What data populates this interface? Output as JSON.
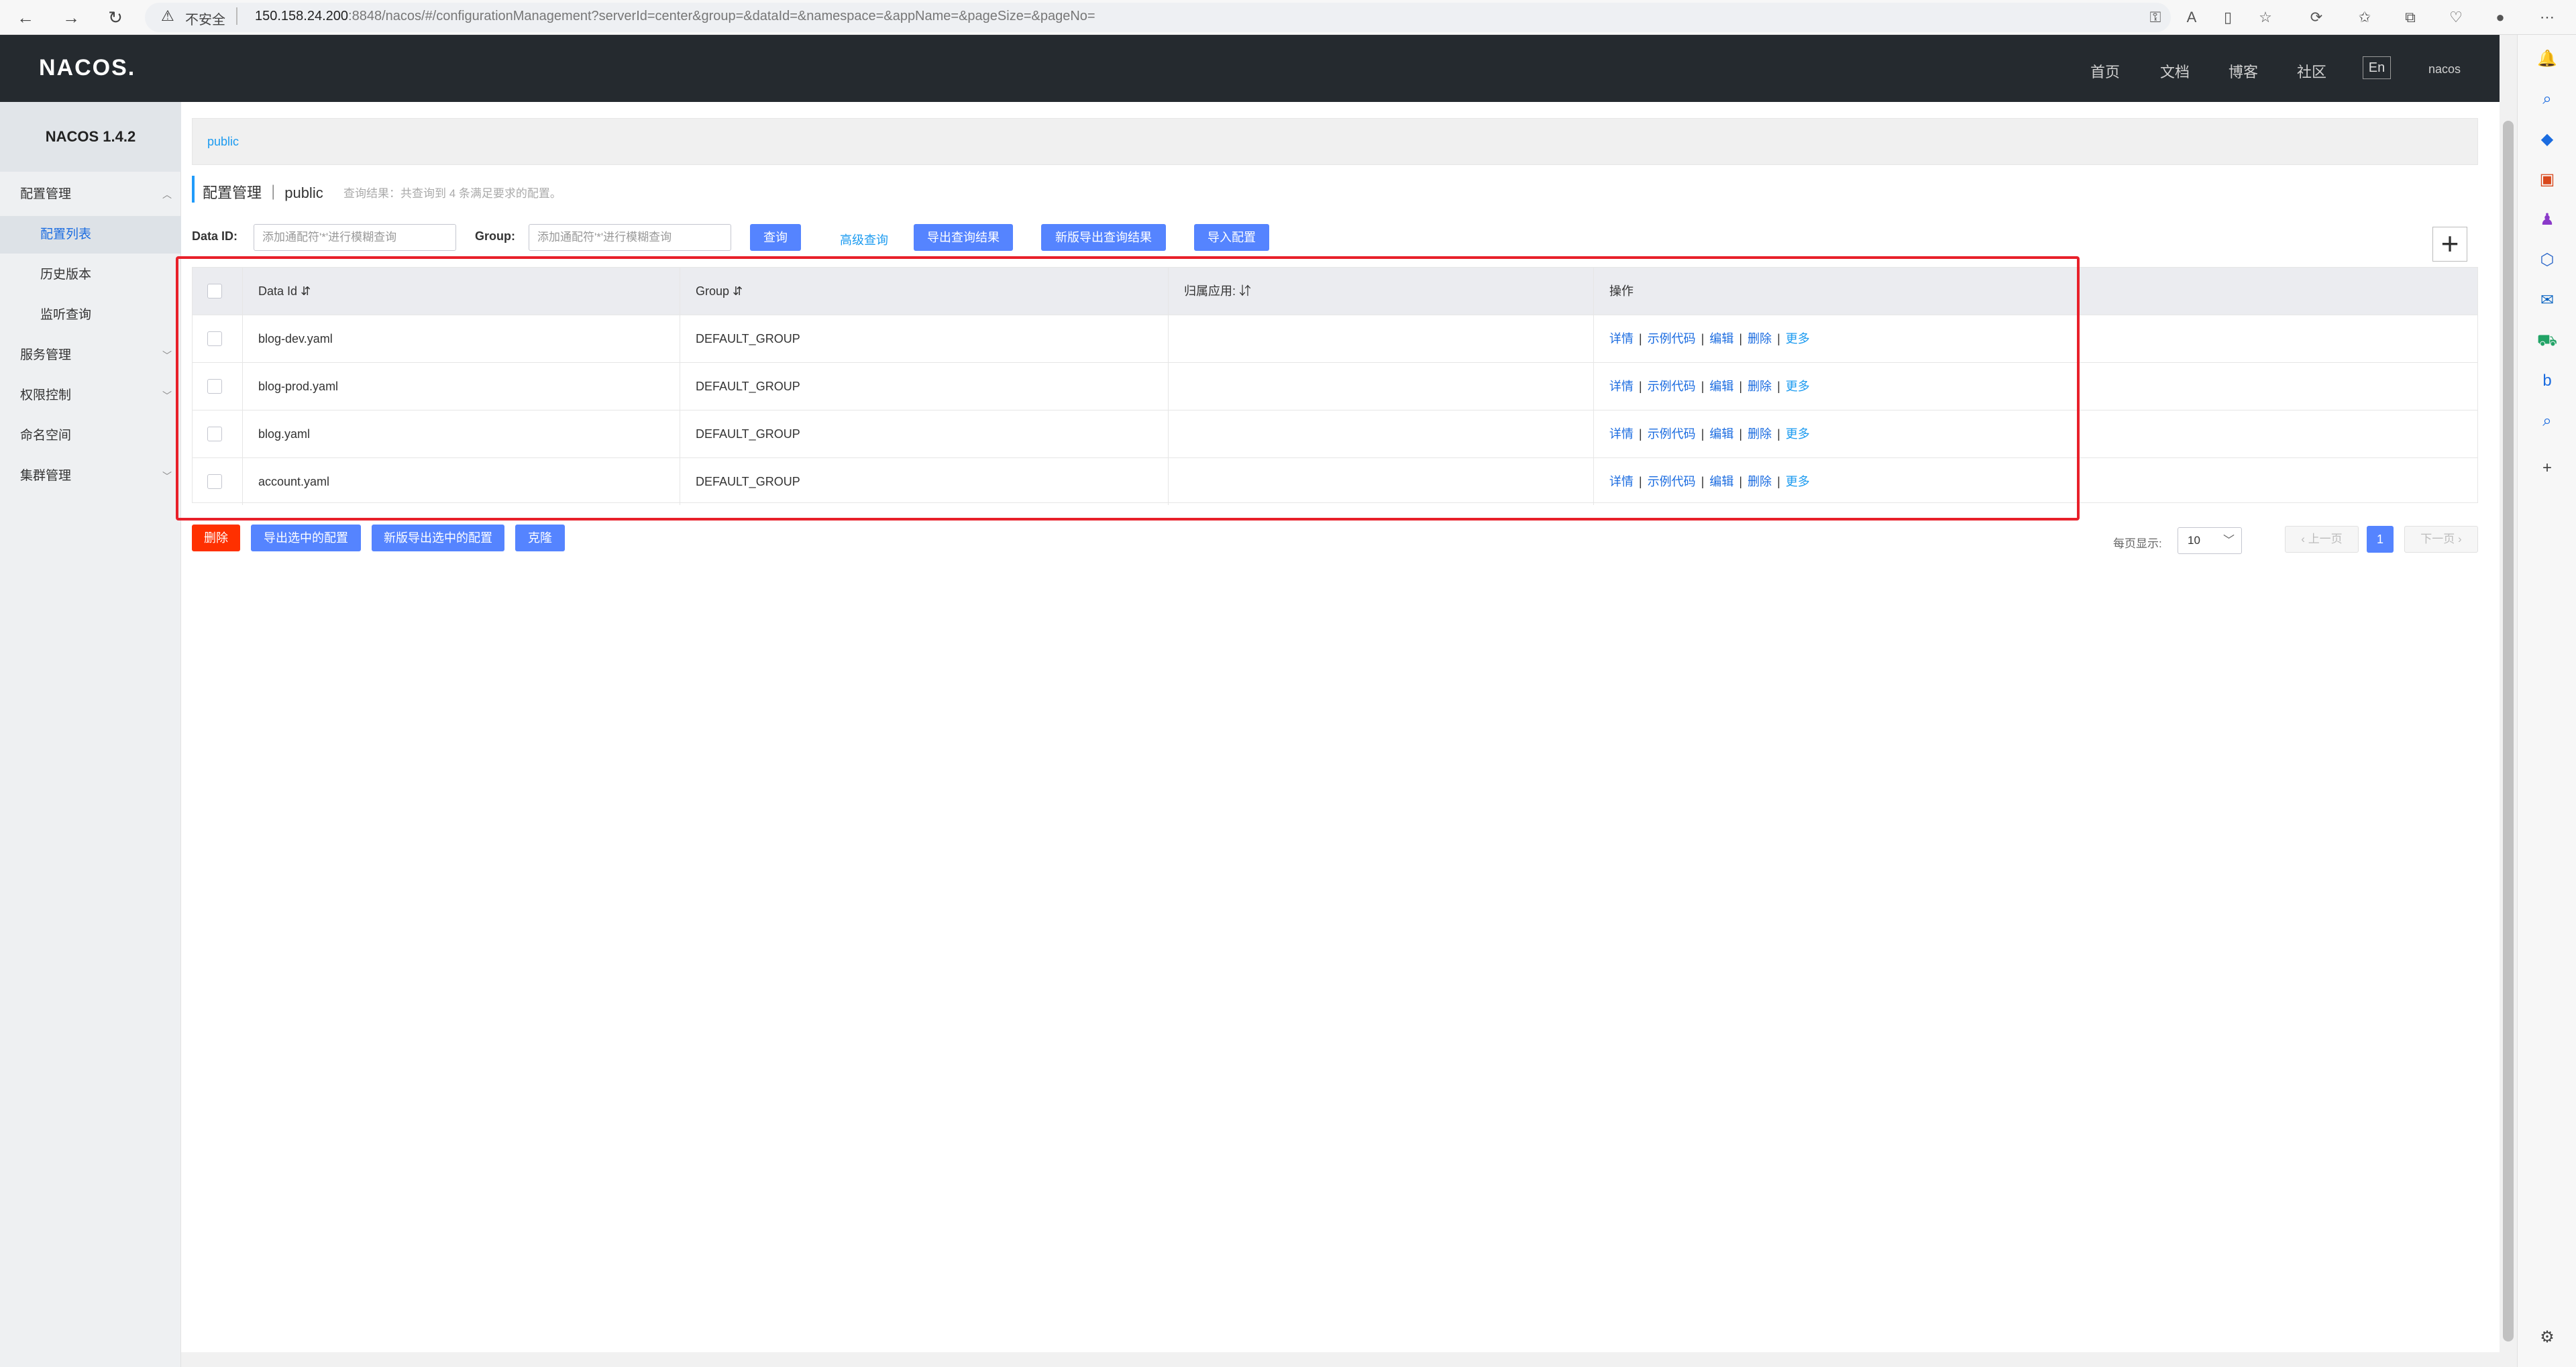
{
  "browser": {
    "security_label": "不安全",
    "url_host": "150.158.24.200",
    "url_rest": ":8848/nacos/#/configurationManagement?serverId=center&group=&dataId=&namespace=&appName=&pageSize=&pageNo="
  },
  "header": {
    "logo": "NACOS.",
    "nav": [
      "首页",
      "文档",
      "博客",
      "社区"
    ],
    "lang": "En",
    "user": "nacos"
  },
  "sidebar": {
    "version": "NACOS 1.4.2",
    "items": [
      {
        "label": "配置管理"
      },
      {
        "label": "配置列表"
      },
      {
        "label": "历史版本"
      },
      {
        "label": "监听查询"
      },
      {
        "label": "服务管理"
      },
      {
        "label": "权限控制"
      },
      {
        "label": "命名空间"
      },
      {
        "label": "集群管理"
      }
    ]
  },
  "namespace_bar": {
    "label": "public"
  },
  "breadcrumb": {
    "title": "配置管理 ｜ public",
    "description": "查询结果：共查询到 4 条满足要求的配置。"
  },
  "search": {
    "dataid_label": "Data ID:",
    "dataid_placeholder": "添加通配符'*'进行模糊查询",
    "group_label": "Group:",
    "group_placeholder": "添加通配符'*'进行模糊查询",
    "query_btn": "查询",
    "advanced_link": "高级查询",
    "export_btn": "导出查询结果",
    "export_new_btn": "新版导出查询结果",
    "import_btn": "导入配置"
  },
  "table": {
    "headers": {
      "data_id": "Data Id",
      "group": "Group",
      "app": "归属应用:",
      "ops": "操作"
    },
    "rows": [
      {
        "data_id": "blog-dev.yaml",
        "group": "DEFAULT_GROUP",
        "app": ""
      },
      {
        "data_id": "blog-prod.yaml",
        "group": "DEFAULT_GROUP",
        "app": ""
      },
      {
        "data_id": "blog.yaml",
        "group": "DEFAULT_GROUP",
        "app": ""
      },
      {
        "data_id": "account.yaml",
        "group": "DEFAULT_GROUP",
        "app": ""
      }
    ],
    "ops": {
      "detail": "详情",
      "sample": "示例代码",
      "edit": "编辑",
      "delete": "删除",
      "more": "更多"
    }
  },
  "footer_actions": {
    "delete": "删除",
    "export_selected": "导出选中的配置",
    "export_selected_new": "新版导出选中的配置",
    "clone": "克隆"
  },
  "pagination": {
    "page_size_label": "每页显示:",
    "page_size": "10",
    "prev": "上一页",
    "current": "1",
    "next": "下一页"
  },
  "colors": {
    "accent": "#5584ff",
    "danger": "#ff3000",
    "highlight": "#e8202a",
    "topbar": "#252a2f"
  }
}
